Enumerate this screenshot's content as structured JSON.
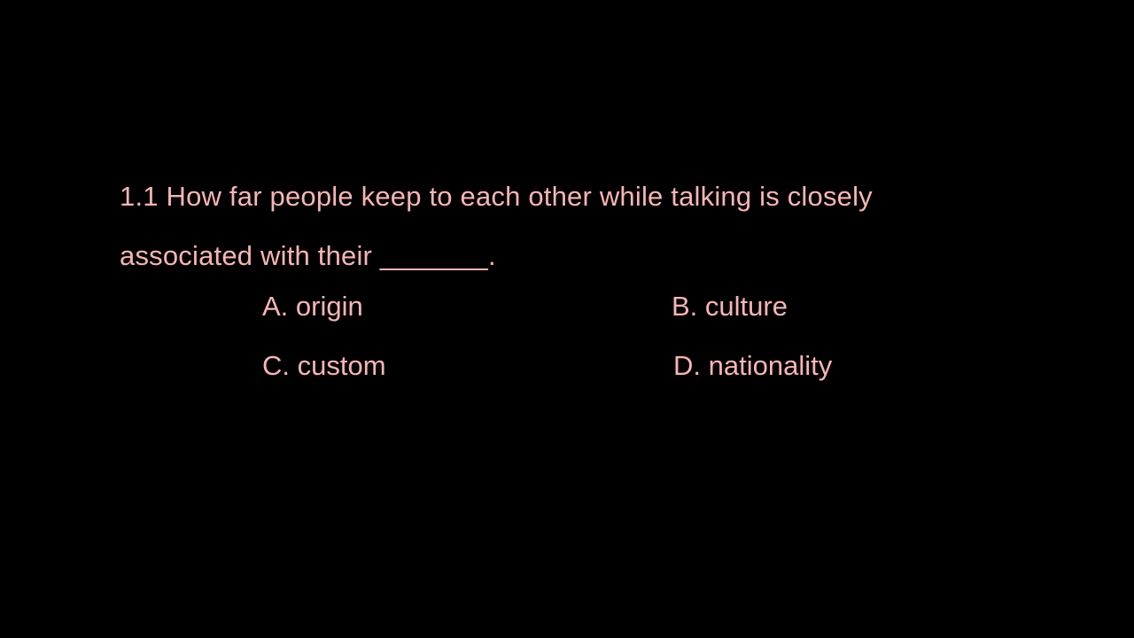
{
  "slide": {
    "text_color": "#f7b5b5",
    "background_color": "#000000",
    "question": {
      "line1": "1.1 How far people keep to each other while talking is closely",
      "line2": "associated with their _______."
    },
    "options": {
      "a": "A. origin",
      "b": "B. culture",
      "c": "C. custom",
      "d": "D. nationality"
    }
  }
}
